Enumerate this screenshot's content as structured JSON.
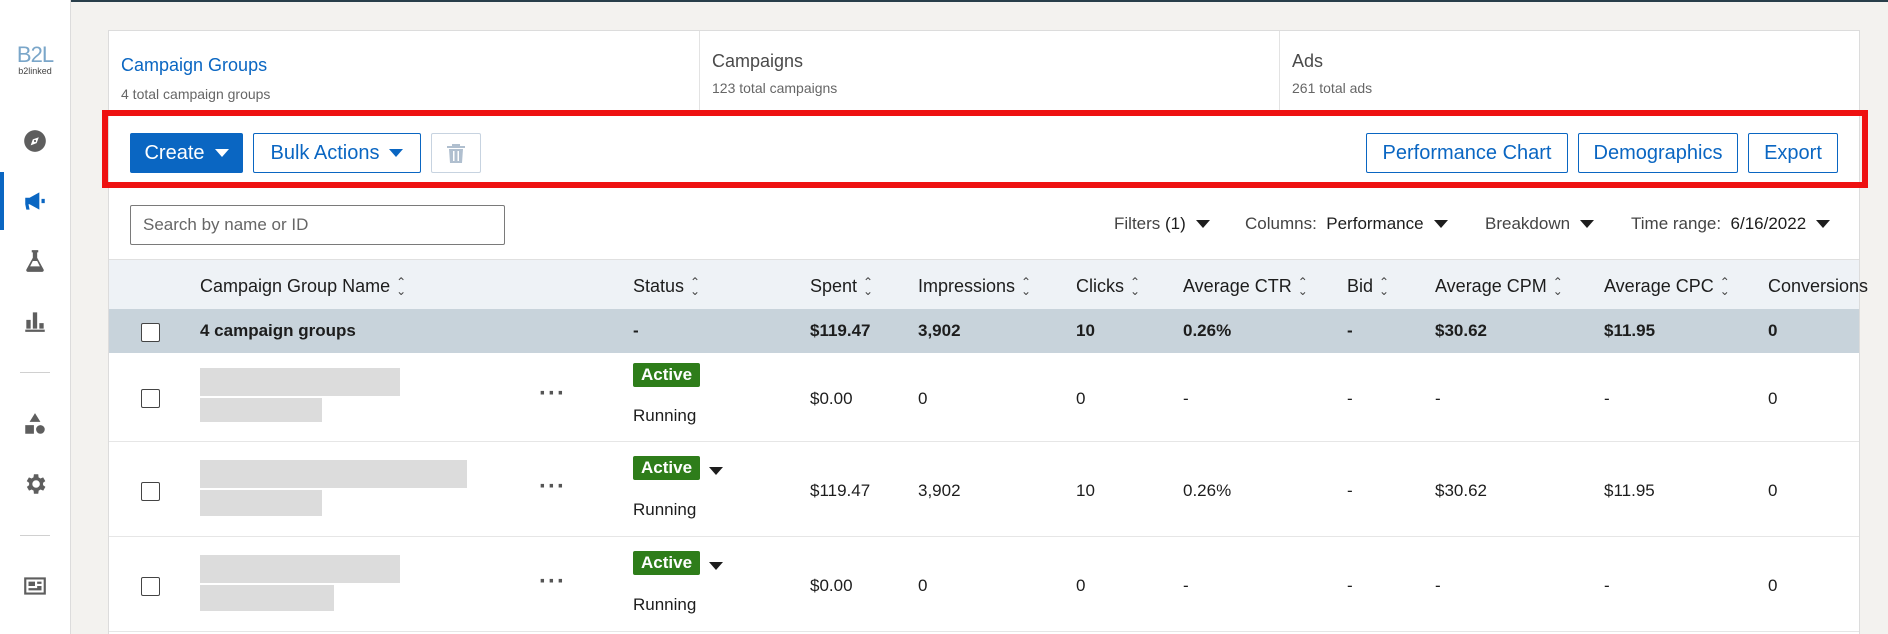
{
  "sidebar": {
    "logo_mark": "B2L",
    "logo_word": "b2linked",
    "icons": [
      "compass-icon",
      "megaphone-icon",
      "flask-icon",
      "bar-chart-icon",
      "shapes-icon",
      "gear-icon",
      "billing-icon"
    ]
  },
  "tabs": [
    {
      "title": "Campaign Groups",
      "subtitle": "4 total campaign groups"
    },
    {
      "title": "Campaigns",
      "subtitle": "123 total campaigns"
    },
    {
      "title": "Ads",
      "subtitle": "261 total ads"
    }
  ],
  "toolbar": {
    "create_label": "Create",
    "bulk_label": "Bulk Actions",
    "performance_chart_label": "Performance Chart",
    "demographics_label": "Demographics",
    "export_label": "Export"
  },
  "filters": {
    "search_placeholder": "Search by name or ID",
    "filters_label": "Filters",
    "filters_count": "(1)",
    "columns_label": "Columns:",
    "columns_value": "Performance",
    "breakdown_label": "Breakdown",
    "time_range_label": "Time range:",
    "time_range_value": "6/16/2022"
  },
  "table": {
    "headers": [
      "Campaign Group Name",
      "Status",
      "Spent",
      "Impressions",
      "Clicks",
      "Average CTR",
      "Bid",
      "Average CPM",
      "Average CPC",
      "Conversions"
    ],
    "summary": {
      "name": "4 campaign groups",
      "status": "-",
      "spent": "$119.47",
      "impressions": "3,902",
      "clicks": "10",
      "ctr": "0.26%",
      "bid": "-",
      "cpm": "$30.62",
      "cpc": "$11.95",
      "conversions": "0"
    },
    "rows": [
      {
        "badge": "Active",
        "state": "Running",
        "spent": "$0.00",
        "impressions": "0",
        "clicks": "0",
        "ctr": "-",
        "bid": "-",
        "cpm": "-",
        "cpc": "-",
        "conversions": "0"
      },
      {
        "badge": "Active",
        "state": "Running",
        "spent": "$119.47",
        "impressions": "3,902",
        "clicks": "10",
        "ctr": "0.26%",
        "bid": "-",
        "cpm": "$30.62",
        "cpc": "$11.95",
        "conversions": "0"
      },
      {
        "badge": "Active",
        "state": "Running",
        "spent": "$0.00",
        "impressions": "0",
        "clicks": "0",
        "ctr": "-",
        "bid": "-",
        "cpm": "-",
        "cpc": "-",
        "conversions": "0"
      }
    ]
  },
  "colors": {
    "accent": "#0a66c2",
    "highlight": "#ee1111",
    "active_badge": "#2e7d1a"
  }
}
